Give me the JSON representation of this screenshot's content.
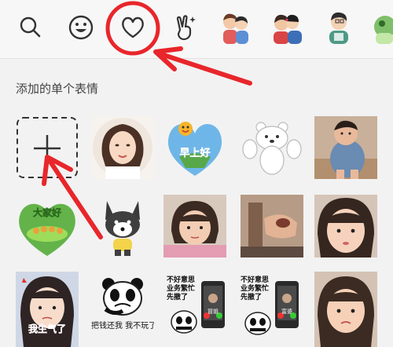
{
  "section_title": "添加的单个表情",
  "tabs": [
    {
      "name": "search-icon"
    },
    {
      "name": "emoji-smile-icon"
    },
    {
      "name": "heart-icon"
    },
    {
      "name": "victory-hand-icon"
    },
    {
      "name": "sticker-pack-couple"
    },
    {
      "name": "sticker-pack-kiss"
    },
    {
      "name": "sticker-pack-boy"
    },
    {
      "name": "sticker-pack-partial"
    }
  ],
  "stickers": {
    "morning_caption": "早上好",
    "greet_caption": "大家好",
    "panda_refund_caption": "把钱还我 我不玩了",
    "busy_caption_1": "不好意思 业务繁忙 先撤了",
    "busy_caption_2": "不好意思 业务繁忙 先撤了",
    "call_label_1": "冒姐",
    "call_label_2": "富婆",
    "angry_caption": "我生气了"
  },
  "colors": {
    "accent_red": "#e8262b",
    "icon_gray": "#333333",
    "background": "#f2f2f2"
  }
}
